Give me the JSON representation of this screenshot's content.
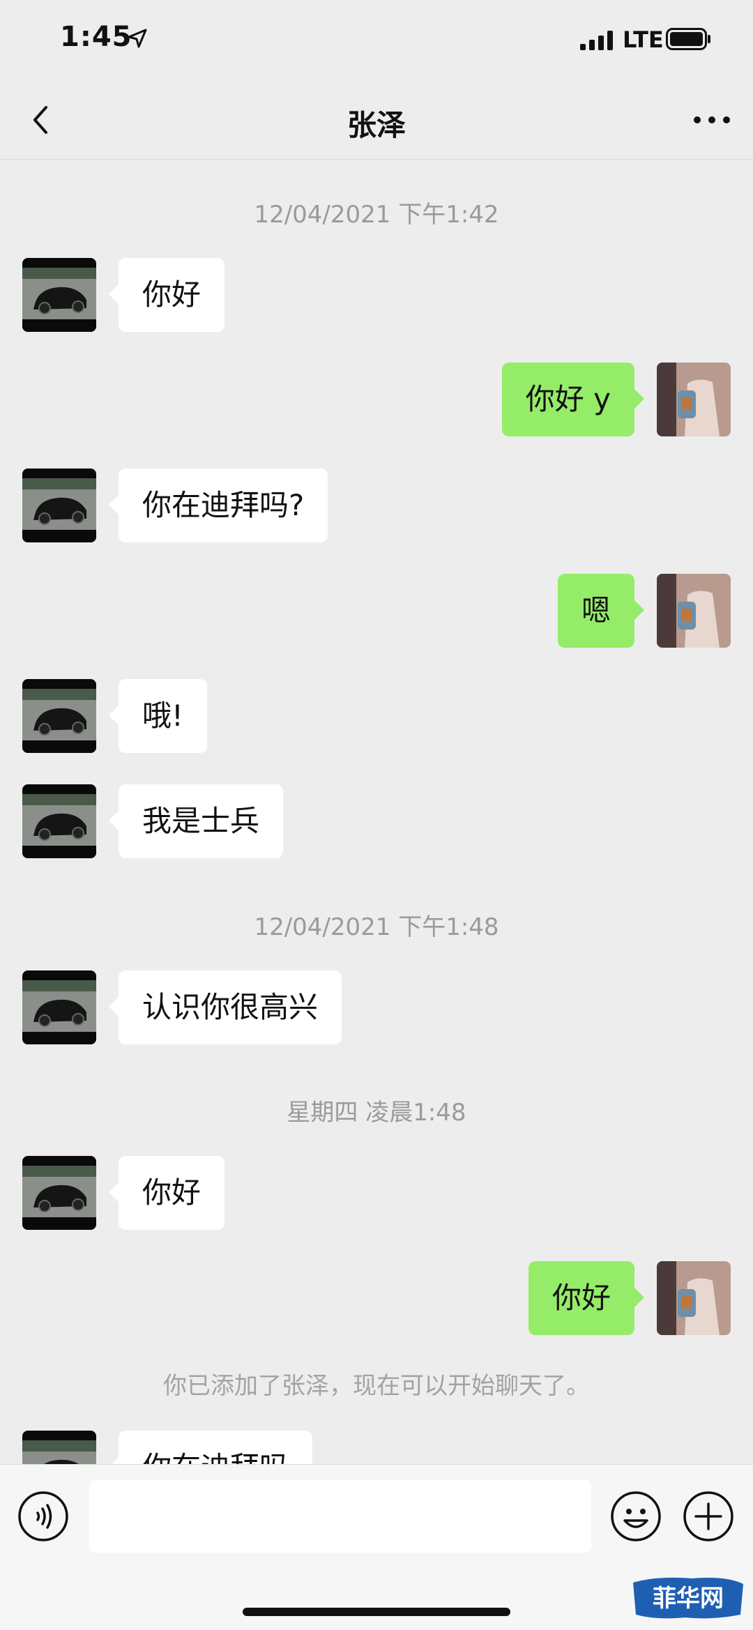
{
  "status_bar": {
    "time": "1:45",
    "network": "LTE"
  },
  "nav": {
    "title": "张泽"
  },
  "timestamps": [
    "12/04/2021 下午1:42",
    "12/04/2021 下午1:48",
    "星期四 凌晨1:48"
  ],
  "messages": [
    {
      "from": "contact",
      "text": "你好"
    },
    {
      "from": "me",
      "text": "你好 y"
    },
    {
      "from": "contact",
      "text": "你在迪拜吗?"
    },
    {
      "from": "me",
      "text": "嗯"
    },
    {
      "from": "contact",
      "text": "哦!"
    },
    {
      "from": "contact",
      "text": "我是士兵"
    },
    {
      "from": "contact",
      "text": "认识你很高兴"
    },
    {
      "from": "contact",
      "text": "你好"
    },
    {
      "from": "me",
      "text": "你好"
    },
    {
      "from": "contact",
      "text": "你在迪拜吗"
    }
  ],
  "system_notice": "你已添加了张泽，现在可以开始聊天了。",
  "input": {
    "value": "",
    "placeholder": ""
  },
  "watermark": "菲华网",
  "colors": {
    "background": "#ededed",
    "incoming_bubble": "#ffffff",
    "outgoing_bubble": "#95ec69"
  },
  "icons": [
    "location-arrow-icon",
    "signal-bars-icon",
    "battery-icon",
    "back-chevron-icon",
    "more-dots-icon",
    "voice-icon",
    "emoji-icon",
    "plus-icon"
  ]
}
